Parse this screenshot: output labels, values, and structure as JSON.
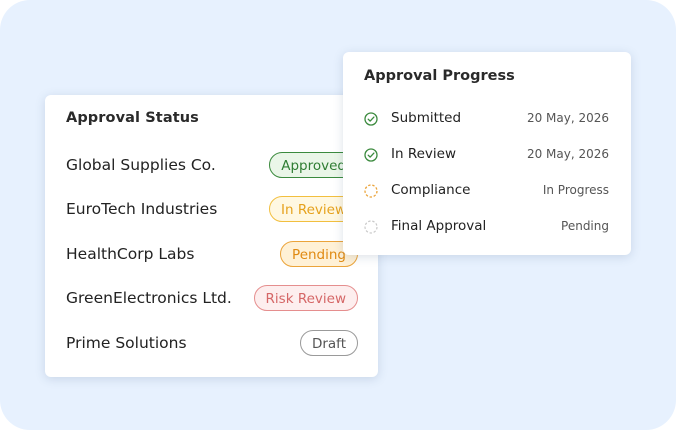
{
  "approval_status": {
    "title": "Approval Status",
    "rows": [
      {
        "name": "Global Supplies Co.",
        "status": "Approved"
      },
      {
        "name": "EuroTech Industries",
        "status": "In Review"
      },
      {
        "name": "HealthCorp Labs",
        "status": "Pending"
      },
      {
        "name": "GreenElectronics Ltd.",
        "status": "Risk Review"
      },
      {
        "name": "Prime Solutions",
        "status": "Draft"
      }
    ]
  },
  "approval_progress": {
    "title": "Approval Progress",
    "steps": [
      {
        "label": "Submitted",
        "status": "20 May, 2026",
        "state": "complete",
        "icon": "check-circle-icon"
      },
      {
        "label": "In Review",
        "status": "20 May, 2026",
        "state": "complete",
        "icon": "check-circle-icon"
      },
      {
        "label": "Compliance",
        "status": "In Progress",
        "state": "in-progress",
        "icon": "dashed-circle-icon"
      },
      {
        "label": "Final Approval",
        "status": "Pending",
        "state": "pending",
        "icon": "dashed-circle-icon"
      }
    ]
  },
  "colors": {
    "background": "#e7f1fe",
    "approved": "#2f7d33",
    "in_review": "#e6a21d",
    "pending": "#e08a12",
    "risk_review": "#d56767",
    "draft": "#555555",
    "step_complete": "#3b8a3e",
    "step_in_progress": "#eba43a",
    "step_pending": "#c9c9c9"
  }
}
